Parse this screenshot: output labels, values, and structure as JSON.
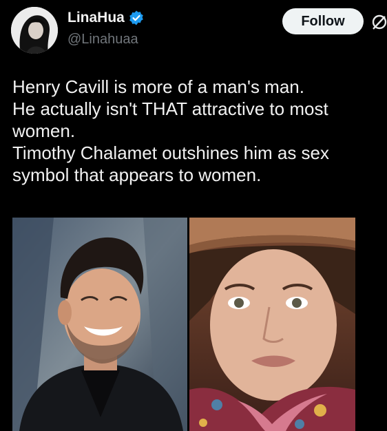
{
  "author": {
    "display_name": "LinaHua",
    "handle": "@Linahuaa",
    "verified": true,
    "avatar_icon": "avatar-portrait"
  },
  "actions": {
    "follow_label": "Follow",
    "grok_icon": "grok-icon"
  },
  "tweet": {
    "lines": [
      "Henry Cavill is more of a man's man.",
      "He actually isn't THAT attractive to most",
      "women.",
      "Timothy Chalamet outshines him as sex",
      "symbol that appears to women."
    ]
  },
  "media": [
    {
      "icon": "photo-left-smiling-man"
    },
    {
      "icon": "photo-right-man-in-hat"
    }
  ],
  "colors": {
    "background": "#000000",
    "text": "#f2f2f2",
    "muted": "#71767b",
    "verified": "#1d9bf0",
    "follow_bg": "#eff3f4"
  }
}
